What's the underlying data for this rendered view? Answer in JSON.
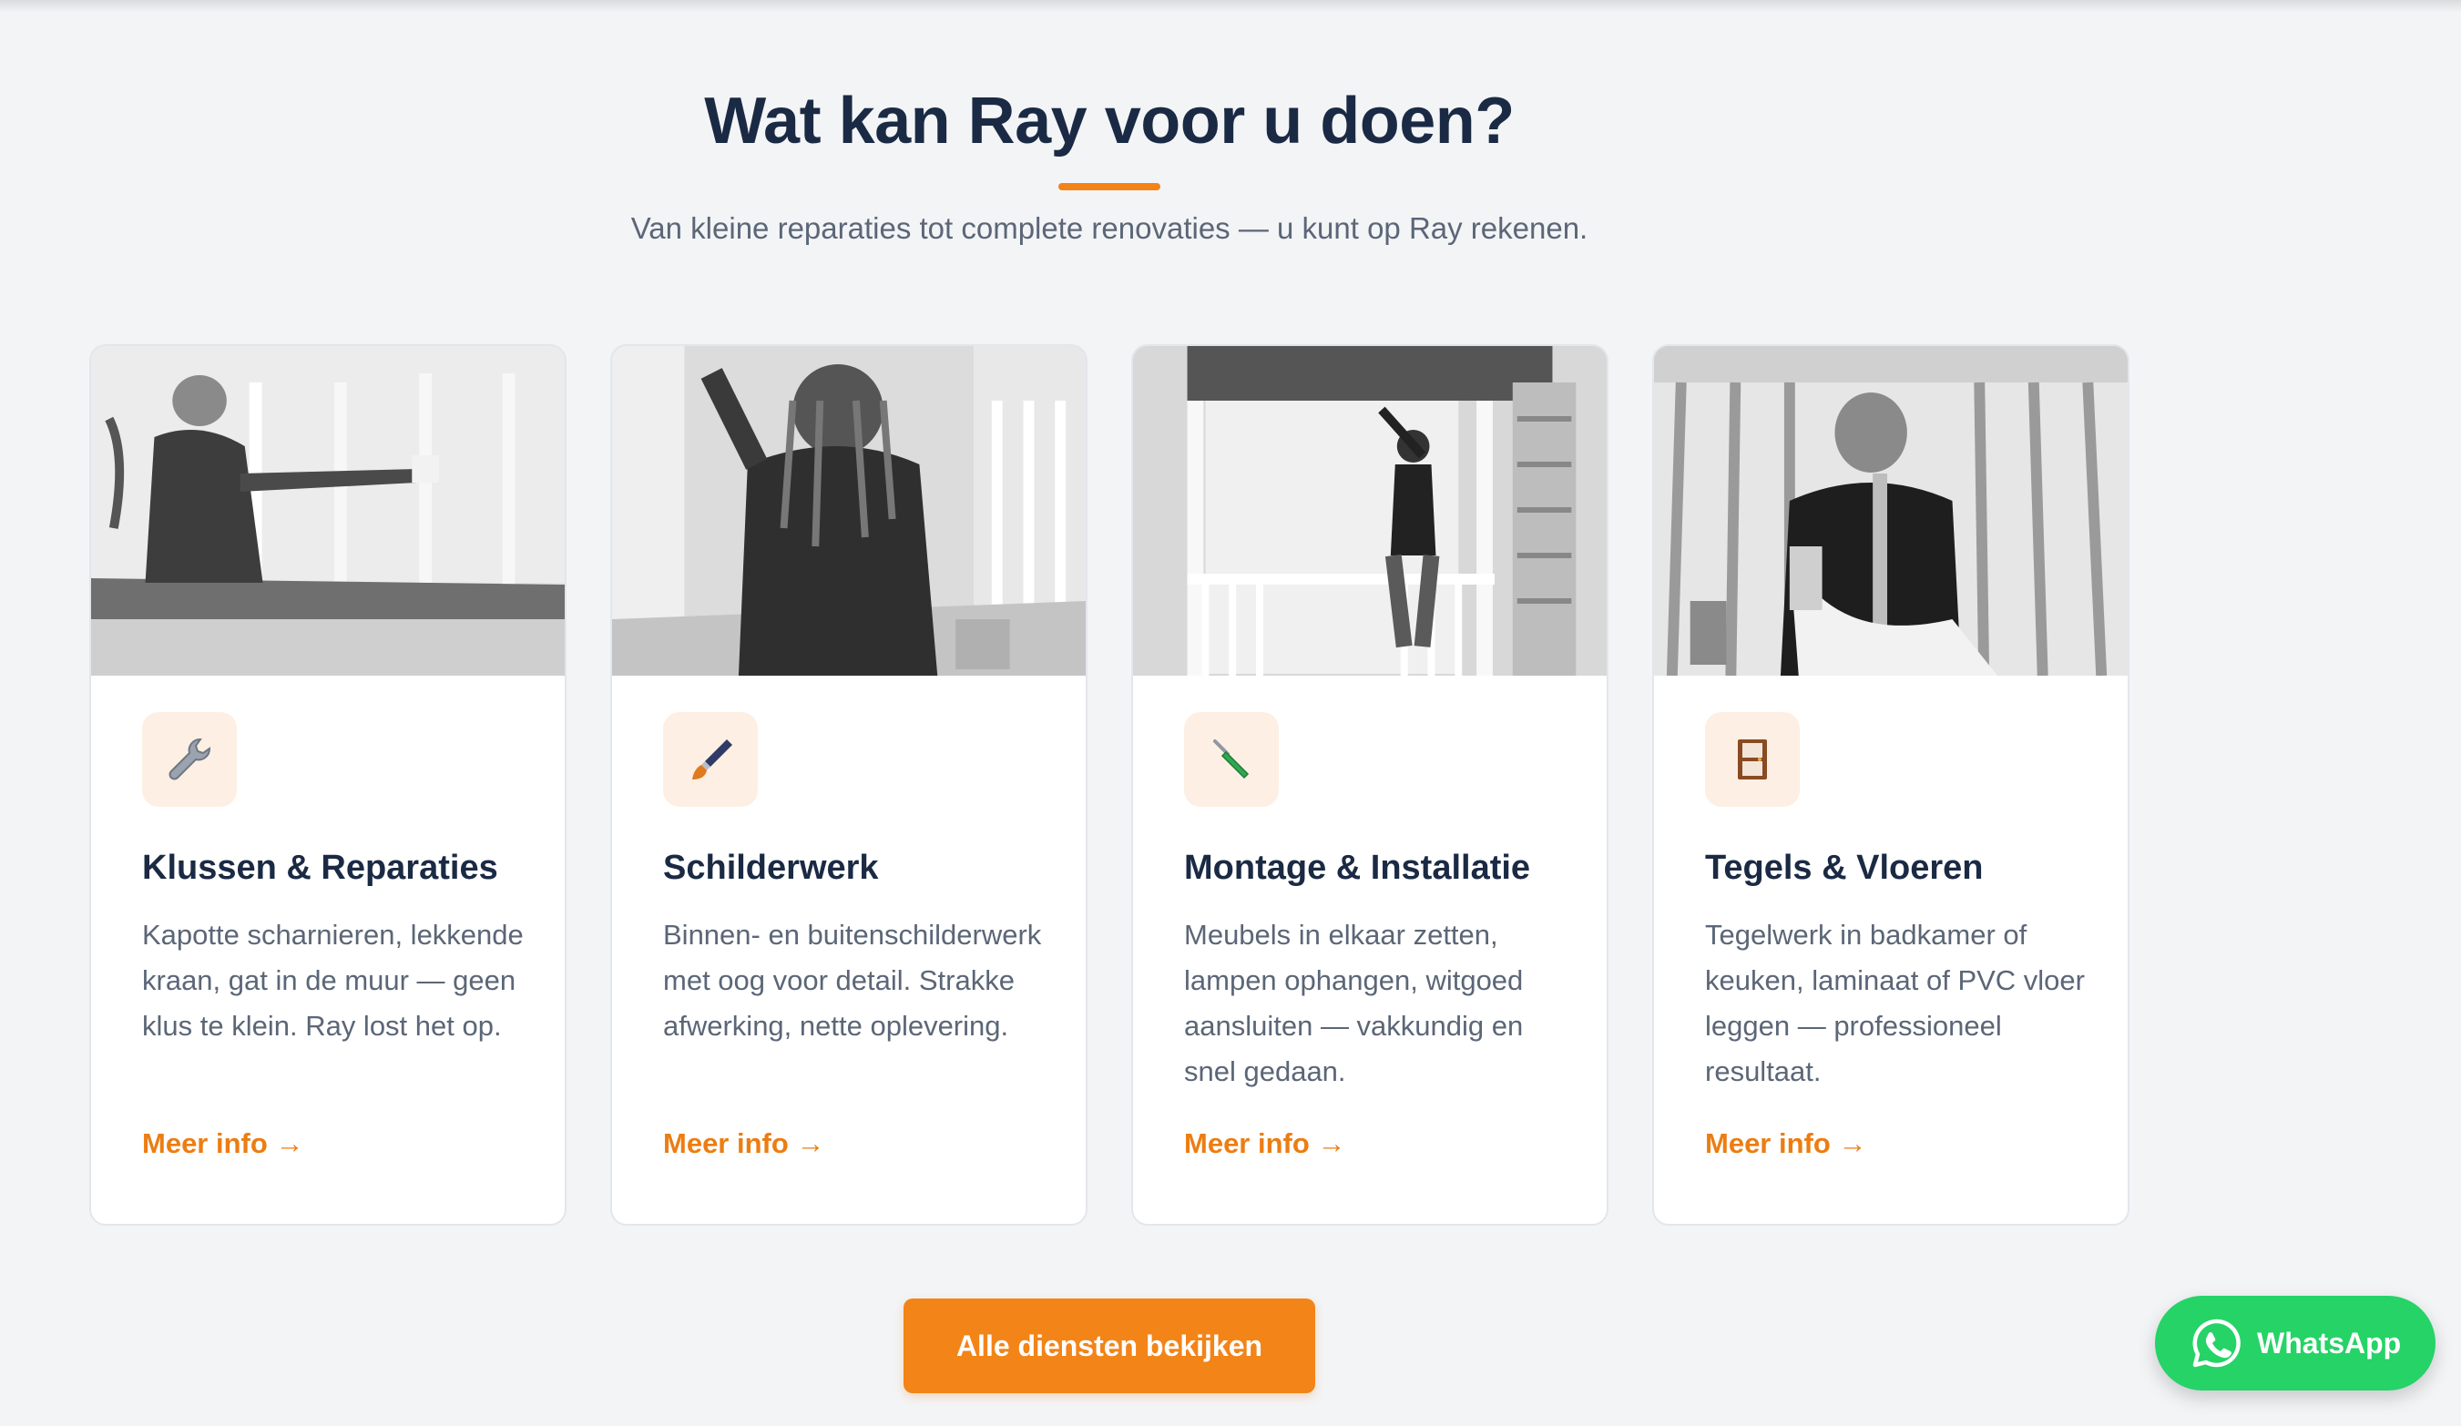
{
  "section": {
    "title": "Wat kan Ray voor u doen?",
    "subtitle": "Van kleine reparaties tot complete renovaties — u kunt op Ray rekenen."
  },
  "cards": [
    {
      "icon": "wrench-icon",
      "title": "Klussen & Reparaties",
      "text": "Kapotte scharnieren, lekkende kraan, gat in de muur — geen klus te klein. Ray lost het op.",
      "link": "Meer info →"
    },
    {
      "icon": "paintbrush-icon",
      "title": "Schilderwerk",
      "text": "Binnen- en buitenschilderwerk met oog voor detail. Strakke afwerking, nette oplevering.",
      "link": "Meer info →"
    },
    {
      "icon": "screwdriver-icon",
      "title": "Montage & Installatie",
      "text": "Meubels in elkaar zetten, lampen ophangen, witgoed aansluiten — vakkundig en snel gedaan.",
      "link": "Meer info →"
    },
    {
      "icon": "door-icon",
      "title": "Tegels & Vloeren",
      "text": "Tegelwerk in badkamer of keuken, laminaat of PVC vloer leggen — professioneel resultaat.",
      "link": "Meer info →"
    }
  ],
  "cta": {
    "label": "Alle diensten bekijken"
  },
  "whatsapp": {
    "label": "WhatsApp"
  },
  "colors": {
    "accent": "#f28418",
    "heading": "#1b2a44",
    "body_text": "#5b6677",
    "icon_bg": "#fdefe3",
    "whatsapp": "#25d366",
    "background": "#f3f4f6"
  }
}
